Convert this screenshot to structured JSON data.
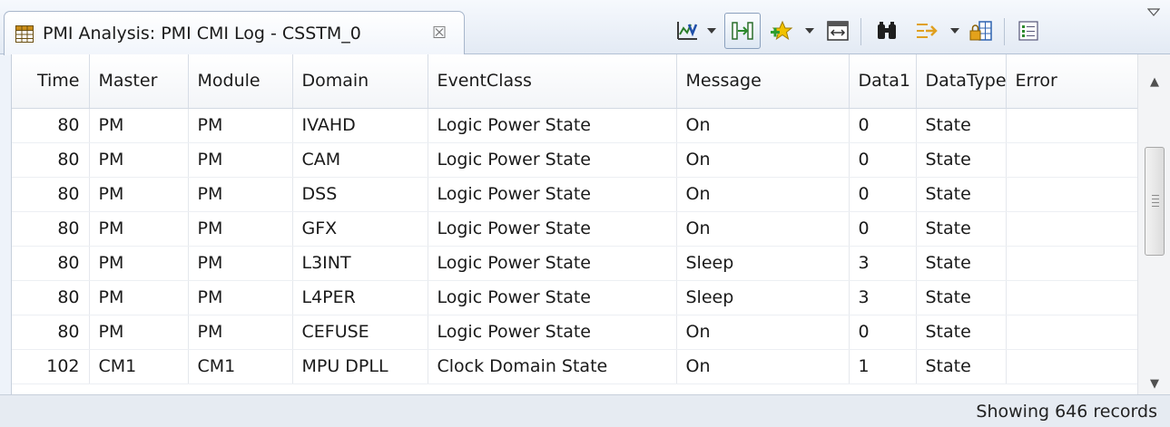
{
  "tab": {
    "icon": "table-icon",
    "title": "PMI Analysis: PMI CMI Log - CSSTM_0",
    "close_symbol": "☒"
  },
  "toolbar": {
    "icons": [
      "chart-icon",
      "dropdown-arrow",
      "column-align-icon",
      "star-add-icon",
      "dropdown-arrow",
      "table-fit-icon",
      "binoculars-icon",
      "filter-icon",
      "dropdown-arrow",
      "lock-table-icon",
      "list-view-icon",
      "view-menu-icon"
    ],
    "pressed": "column-align-icon"
  },
  "table": {
    "columns": [
      "Time",
      "Master",
      "Module",
      "Domain",
      "EventClass",
      "Message",
      "Data1",
      "DataType",
      "Error"
    ],
    "rows": [
      {
        "time": "80",
        "master": "PM",
        "module": "PM",
        "domain": "IVAHD",
        "eventclass": "Logic Power State",
        "message": "On",
        "data1": "0",
        "datatype": "State",
        "error": ""
      },
      {
        "time": "80",
        "master": "PM",
        "module": "PM",
        "domain": "CAM",
        "eventclass": "Logic Power State",
        "message": "On",
        "data1": "0",
        "datatype": "State",
        "error": ""
      },
      {
        "time": "80",
        "master": "PM",
        "module": "PM",
        "domain": "DSS",
        "eventclass": "Logic Power State",
        "message": "On",
        "data1": "0",
        "datatype": "State",
        "error": ""
      },
      {
        "time": "80",
        "master": "PM",
        "module": "PM",
        "domain": "GFX",
        "eventclass": "Logic Power State",
        "message": "On",
        "data1": "0",
        "datatype": "State",
        "error": ""
      },
      {
        "time": "80",
        "master": "PM",
        "module": "PM",
        "domain": "L3INT",
        "eventclass": "Logic Power State",
        "message": "Sleep",
        "data1": "3",
        "datatype": "State",
        "error": ""
      },
      {
        "time": "80",
        "master": "PM",
        "module": "PM",
        "domain": "L4PER",
        "eventclass": "Logic Power State",
        "message": "Sleep",
        "data1": "3",
        "datatype": "State",
        "error": ""
      },
      {
        "time": "80",
        "master": "PM",
        "module": "PM",
        "domain": "CEFUSE",
        "eventclass": "Logic Power State",
        "message": "On",
        "data1": "0",
        "datatype": "State",
        "error": ""
      },
      {
        "time": "102",
        "master": "CM1",
        "module": "CM1",
        "domain": "MPU DPLL",
        "eventclass": "Clock Domain State",
        "message": "On",
        "data1": "1",
        "datatype": "State",
        "error": ""
      }
    ]
  },
  "scrollbar": {
    "position_fraction": 0.0
  },
  "status": {
    "text": "Showing 646 records"
  },
  "colors": {
    "header_bg": "#eef3fa",
    "tab_border": "#a7b6cb",
    "grid_line": "#e5e8ed"
  }
}
